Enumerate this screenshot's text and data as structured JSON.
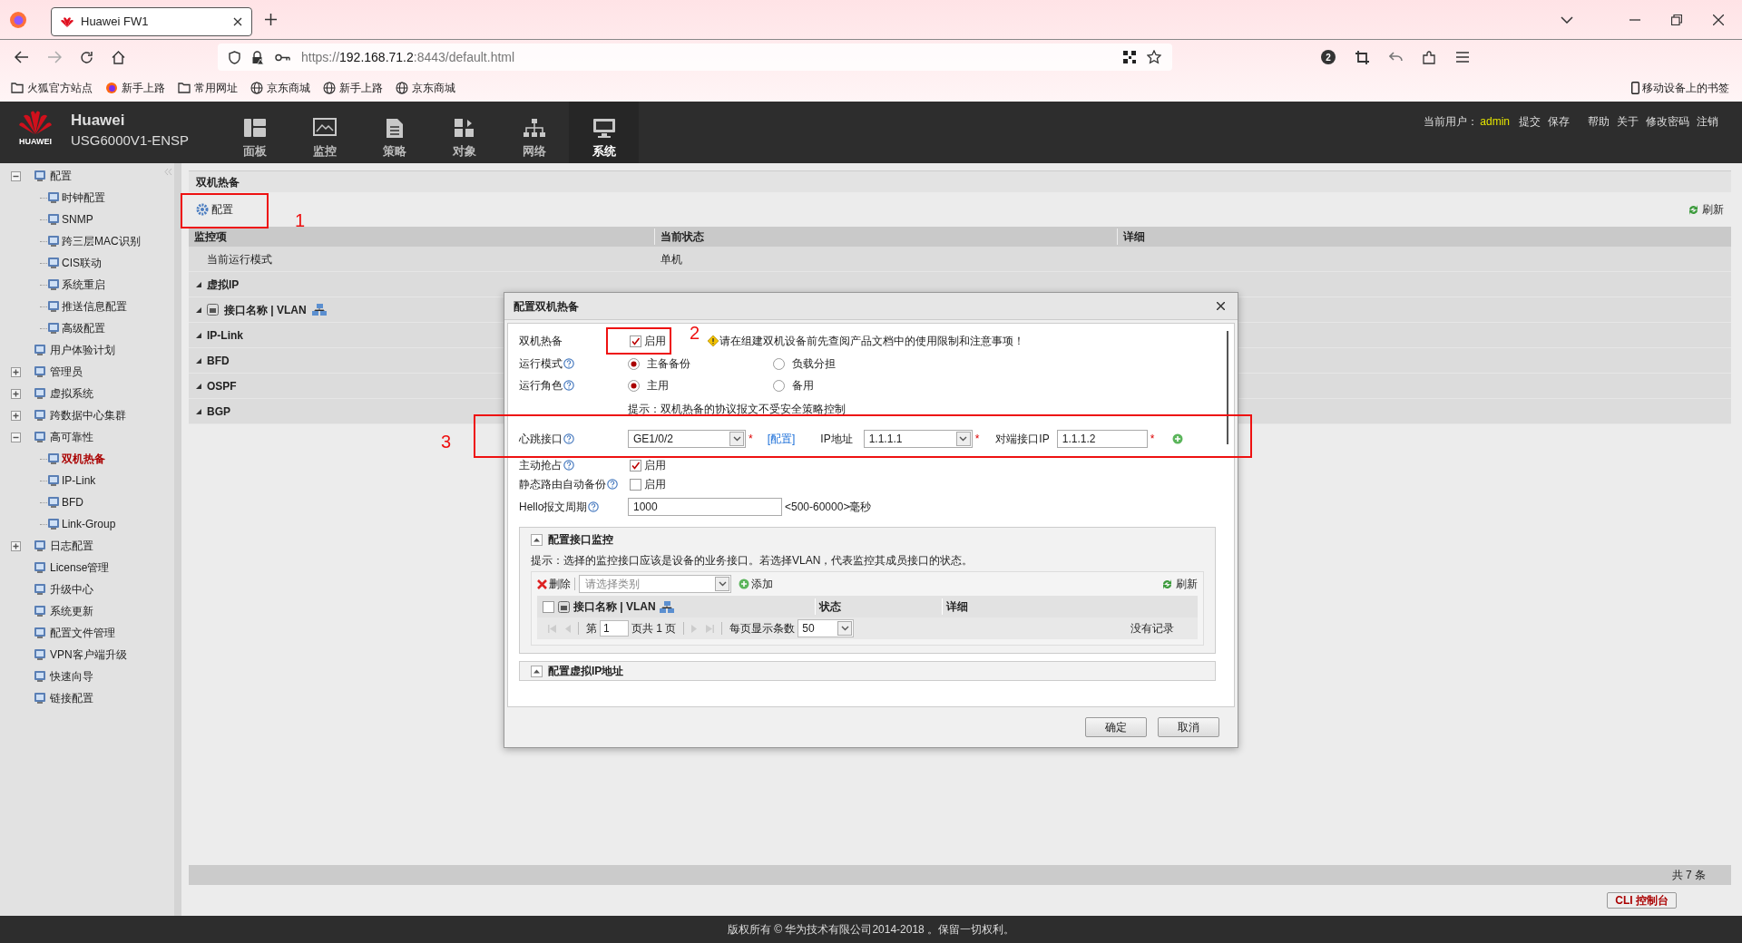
{
  "browser": {
    "tab_title": "Huawei FW1",
    "url_prefix": "https://",
    "url_host": "192.168.71.2",
    "url_rest": ":8443/default.html",
    "notification_count": "2",
    "bookmarks": [
      {
        "kind": "folder",
        "label": "火狐官方站点"
      },
      {
        "kind": "firefox",
        "label": "新手上路"
      },
      {
        "kind": "folder",
        "label": "常用网址"
      },
      {
        "kind": "globe",
        "label": "京东商城"
      },
      {
        "kind": "globe",
        "label": "新手上路"
      },
      {
        "kind": "globe",
        "label": "京东商城"
      }
    ],
    "mobile_bookmarks": "移动设备上的书签"
  },
  "header": {
    "logo_text": "HUAWEI",
    "brand": "Huawei",
    "model": "USG6000V1-ENSP",
    "nav": [
      {
        "kind": "dashboard",
        "label": "面板",
        "selected": false
      },
      {
        "kind": "monitor",
        "label": "监控",
        "selected": false
      },
      {
        "kind": "policy",
        "label": "策略",
        "selected": false
      },
      {
        "kind": "object",
        "label": "对象",
        "selected": false
      },
      {
        "kind": "network",
        "label": "网络",
        "selected": false
      },
      {
        "kind": "system",
        "label": "系统",
        "selected": true
      }
    ],
    "user_label": "当前用户：",
    "user": "admin",
    "links": [
      "提交",
      "保存",
      "帮助",
      "关于",
      "修改密码",
      "注销"
    ]
  },
  "sidebar": {
    "items": [
      {
        "label": "配置",
        "expanded": true,
        "selected": false,
        "children": [
          {
            "label": "时钟配置",
            "selected": false
          },
          {
            "label": "SNMP",
            "selected": false
          },
          {
            "label": "跨三层MAC识别",
            "selected": false
          },
          {
            "label": "CIS联动",
            "selected": false
          },
          {
            "label": "系统重启",
            "selected": false
          },
          {
            "label": "推送信息配置",
            "selected": false
          },
          {
            "label": "高级配置",
            "selected": false
          }
        ]
      },
      {
        "label": "用户体验计划",
        "selected": false
      },
      {
        "label": "管理员",
        "expanded": false,
        "selected": false
      },
      {
        "label": "虚拟系统",
        "expanded": false,
        "selected": false
      },
      {
        "label": "跨数据中心集群",
        "expanded": false,
        "selected": false
      },
      {
        "label": "高可靠性",
        "expanded": true,
        "selected": false,
        "children": [
          {
            "label": "双机热备",
            "selected": true
          },
          {
            "label": "IP-Link",
            "selected": false
          },
          {
            "label": "BFD",
            "selected": false
          },
          {
            "label": "Link-Group",
            "selected": false
          }
        ]
      },
      {
        "label": "日志配置",
        "expanded": false,
        "selected": false
      },
      {
        "label": "License管理",
        "selected": false
      },
      {
        "label": "升级中心",
        "selected": false
      },
      {
        "label": "系统更新",
        "selected": false
      },
      {
        "label": "配置文件管理",
        "selected": false
      },
      {
        "label": "VPN客户端升级",
        "selected": false
      },
      {
        "label": "快速向导",
        "selected": false
      },
      {
        "label": "链接配置",
        "selected": false
      }
    ]
  },
  "main": {
    "title": "双机热备",
    "config_button": "配置",
    "refresh": "刷新",
    "columns": [
      "监控项",
      "当前状态",
      "详细"
    ],
    "rows": [
      {
        "kind": "row",
        "cells": [
          "当前运行模式",
          "单机"
        ]
      },
      {
        "kind": "group",
        "label": "虚拟IP",
        "expanded": true
      },
      {
        "kind": "interface_group",
        "label": "接口名称 | VLAN",
        "expanded": true
      },
      {
        "kind": "group",
        "label": "IP-Link",
        "expanded": true
      },
      {
        "kind": "group",
        "label": "BFD",
        "expanded": true
      },
      {
        "kind": "group",
        "label": "OSPF",
        "expanded": true
      },
      {
        "kind": "group",
        "label": "BGP",
        "expanded": true
      }
    ],
    "total": "共 7 条"
  },
  "dialog": {
    "title": "配置双机热备",
    "hot_standby": {
      "label": "双机热备",
      "option": "启用",
      "checked": true,
      "warning": "请在组建双机设备前先查阅产品文档中的使用限制和注意事项！"
    },
    "run_mode": {
      "label": "运行模式",
      "options": [
        {
          "label": "主备备份",
          "selected": true
        },
        {
          "label": "负载分担",
          "selected": false
        }
      ]
    },
    "run_role": {
      "label": "运行角色",
      "options": [
        {
          "label": "主用",
          "selected": true
        },
        {
          "label": "备用",
          "selected": false
        }
      ]
    },
    "hint": "提示：双机热备的协议报文不受安全策略控制",
    "heartbeat": {
      "label": "心跳接口",
      "interface": "GE1/0/2",
      "required_mark": "*",
      "config_link": "[配置]",
      "ip_label": "IP地址",
      "ip": "1.1.1.1",
      "peer_label": "对端接口IP",
      "peer_ip": "1.1.1.2"
    },
    "preempt": {
      "label": "主动抢占",
      "option": "启用",
      "checked": true
    },
    "static_route": {
      "label": "静态路由自动备份",
      "option": "启用",
      "checked": false
    },
    "hello": {
      "label": "Hello报文周期",
      "value": "1000",
      "range": "<500-60000>毫秒"
    },
    "monitor_section": {
      "title": "配置接口监控",
      "hint": "提示：选择的监控接口应该是设备的业务接口。若选择VLAN，代表监控其成员接口的状态。",
      "delete": "删除",
      "type_placeholder": "请选择类别",
      "add": "添加",
      "refresh": "刷新",
      "columns": [
        "接口名称 | VLAN",
        "状态",
        "详细"
      ],
      "select_all_checked": false,
      "page_prefix": "第",
      "page": "1",
      "page_total": "页共 1 页",
      "page_size_label": "每页显示条数",
      "page_size": "50",
      "empty": "没有记录"
    },
    "vip_section": {
      "title": "配置虚拟IP地址"
    },
    "ok": "确定",
    "cancel": "取消"
  },
  "annotations": [
    "1",
    "2",
    "3"
  ],
  "footer": {
    "copyright": "版权所有 © 华为技术有限公司2014-2018 。保留一切权利。",
    "cli_button": "CLI 控制台"
  }
}
